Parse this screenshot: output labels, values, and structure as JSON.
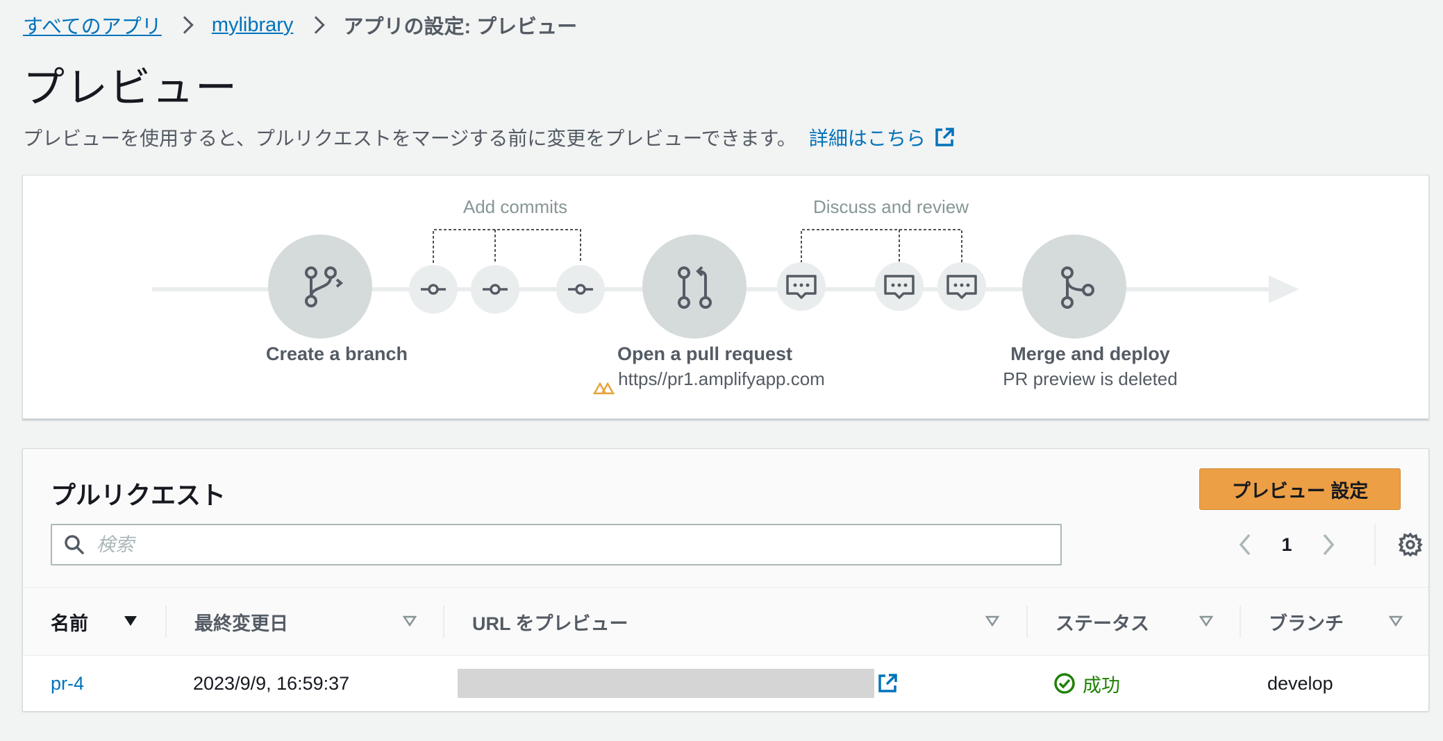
{
  "breadcrumb": {
    "items": [
      "すべてのアプリ",
      "mylibrary"
    ],
    "current": "アプリの設定: プレビュー"
  },
  "page": {
    "title": "プレビュー",
    "description": "プレビューを使用すると、プルリクエストをマージする前に変更をプレビューできます。",
    "learn_more": "詳細はこちら"
  },
  "workflow": {
    "group_labels": [
      "Add commits",
      "Discuss and review"
    ],
    "steps": [
      {
        "title": "Create a branch",
        "subtitle": ""
      },
      {
        "title": "Open a pull request",
        "subtitle": "https//pr1.amplifyapp.com"
      },
      {
        "title": "Merge and deploy",
        "subtitle": "PR preview is deleted"
      }
    ],
    "icons": [
      "branch-icon",
      "commit-icon",
      "commit-icon",
      "commit-icon",
      "pull-request-icon",
      "comment-icon",
      "comment-icon",
      "comment-icon",
      "merge-icon",
      "amplify-logo-icon"
    ]
  },
  "pull_requests": {
    "title": "プルリクエスト",
    "settings_button": "プレビュー 設定",
    "search_placeholder": "検索",
    "pagination": {
      "current_page": "1"
    },
    "columns": [
      "名前",
      "最終変更日",
      "URL をプレビュー",
      "ステータス",
      "ブランチ"
    ],
    "sorted_column": "名前",
    "rows": [
      {
        "name": "pr-4",
        "modified": "2023/9/9, 16:59:37",
        "url": "",
        "status": "成功",
        "branch": "develop"
      }
    ]
  },
  "colors": {
    "link": "#0073bb",
    "primary_button": "#ec9f44",
    "success": "#1d8102",
    "page_bg": "#f2f3f3"
  }
}
